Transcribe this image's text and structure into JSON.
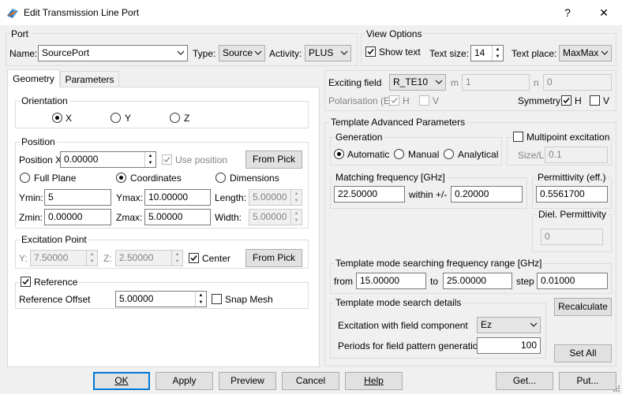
{
  "window": {
    "title": "Edit Transmission Line Port",
    "help": "?",
    "close": "✕"
  },
  "port": {
    "group": "Port",
    "name_label": "Name:",
    "name_value": "SourcePort",
    "type_label": "Type:",
    "type_value": "Source",
    "activity_label": "Activity:",
    "activity_value": "PLUS"
  },
  "view_options": {
    "group": "View Options",
    "show_text": "Show text",
    "text_size_label": "Text size:",
    "text_size_value": "14",
    "text_place_label": "Text place:",
    "text_place_value": "MaxMax"
  },
  "tabs": {
    "geometry": "Geometry",
    "parameters": "Parameters"
  },
  "orientation": {
    "group": "Orientation",
    "x": "X",
    "y": "Y",
    "z": "Z"
  },
  "position": {
    "group": "Position",
    "position_x_label": "Position X",
    "position_x_value": "0.00000",
    "use_position": "Use position",
    "from_pick": "From Pick",
    "full_plane": "Full Plane",
    "coordinates": "Coordinates",
    "dimensions": "Dimensions",
    "ymin_label": "Ymin:",
    "ymin_value": "5",
    "ymax_label": "Ymax:",
    "ymax_value": "10.00000",
    "length_label": "Length:",
    "length_value": "5.00000",
    "zmin_label": "Zmin:",
    "zmin_value": "0.00000",
    "zmax_label": "Zmax:",
    "zmax_value": "5.00000",
    "width_label": "Width:",
    "width_value": "5.00000"
  },
  "excitation_point": {
    "group": "Excitation Point",
    "y_label": "Y:",
    "y_value": "7.50000",
    "z_label": "Z:",
    "z_value": "2.50000",
    "center": "Center",
    "from_pick": "From Pick"
  },
  "reference": {
    "group": "Reference",
    "offset_label": "Reference Offset",
    "offset_value": "5.00000",
    "snap_mesh": "Snap Mesh"
  },
  "exciting": {
    "label": "Exciting field",
    "value": "R_TE10",
    "m_label": "m",
    "m_value": "1",
    "n_label": "n",
    "n_value": "0",
    "polarisation_label": "Polarisation (E)",
    "pol_h": "H",
    "pol_v": "V",
    "symmetry_label": "Symmetry",
    "sym_h": "H",
    "sym_v": "V"
  },
  "template": {
    "group": "Template Advanced Parameters",
    "generation_group": "Generation",
    "automatic": "Automatic",
    "manual": "Manual",
    "analytical": "Analytical",
    "multipoint": "Multipoint excitation",
    "size_label": "Size/L",
    "size_value": "0.1",
    "matching_group": "Matching frequency [GHz]",
    "matching_value": "22.50000",
    "within_label": "within +/-",
    "within_value": "0.20000",
    "permittivity_group": "Permittivity (eff.)",
    "permittivity_value": "0.5561700",
    "diel_group": "Diel. Permittivity",
    "diel_value": "0",
    "range_group": "Template mode searching frequency range [GHz]",
    "from_label": "from",
    "from_value": "15.00000",
    "to_label": "to",
    "to_value": "25.00000",
    "step_label": "step",
    "step_value": "0.01000",
    "search_group": "Template mode search details",
    "excitation_component_label": "Excitation with field component",
    "excitation_component_value": "Ez",
    "periods_label": "Periods for field pattern generation",
    "periods_value": "100",
    "recalculate": "Recalculate",
    "set_all": "Set All"
  },
  "footer": {
    "ok": "OK",
    "apply": "Apply",
    "preview": "Preview",
    "cancel": "Cancel",
    "help": "Help",
    "get": "Get...",
    "put": "Put..."
  }
}
